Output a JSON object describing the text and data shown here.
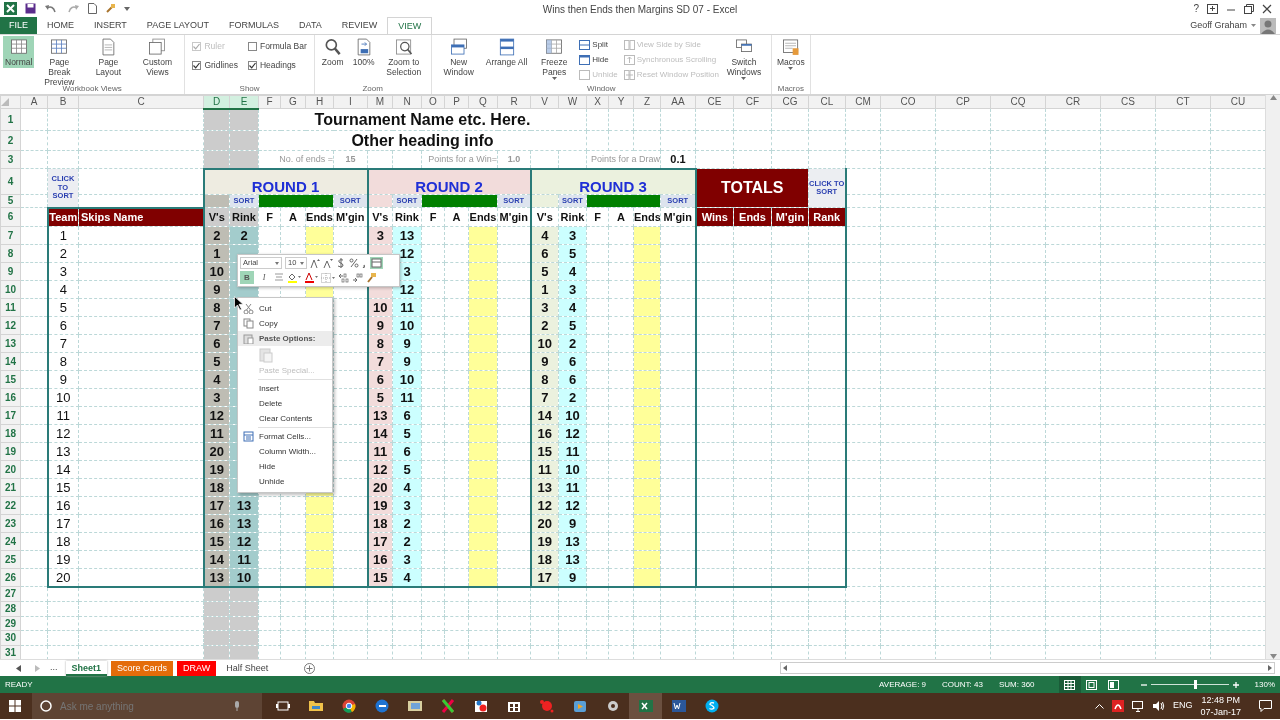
{
  "titlebar": {
    "title": "Wins then Ends then Margins SD 07 - Excel",
    "help": "?",
    "user": "Geoff Graham"
  },
  "ribbon_tabs": [
    {
      "label": "FILE",
      "kind": "file",
      "selected": false
    },
    {
      "label": "HOME",
      "kind": "tab",
      "selected": false
    },
    {
      "label": "INSERT",
      "kind": "tab",
      "selected": false
    },
    {
      "label": "PAGE LAYOUT",
      "kind": "tab",
      "selected": false
    },
    {
      "label": "FORMULAS",
      "kind": "tab",
      "selected": false
    },
    {
      "label": "DATA",
      "kind": "tab",
      "selected": false
    },
    {
      "label": "REVIEW",
      "kind": "tab",
      "selected": false
    },
    {
      "label": "VIEW",
      "kind": "tab",
      "selected": true
    }
  ],
  "ribbon_groups": [
    {
      "label": "Workbook Views",
      "items": [
        {
          "kind": "large",
          "label": "Normal",
          "selected": true,
          "disabled": false,
          "dropdown": false
        },
        {
          "kind": "large",
          "label": "Page Break Preview",
          "selected": false,
          "disabled": false,
          "dropdown": false
        },
        {
          "kind": "large",
          "label": "Page Layout",
          "selected": false,
          "disabled": false,
          "dropdown": false
        },
        {
          "kind": "large",
          "label": "Custom Views",
          "selected": false,
          "disabled": false,
          "dropdown": false
        }
      ]
    },
    {
      "label": "Show",
      "items": [
        {
          "kind": "check",
          "label": "Ruler",
          "checked": true,
          "disabled": true
        },
        {
          "kind": "check",
          "label": "Formula Bar",
          "checked": false,
          "disabled": false
        },
        {
          "kind": "check",
          "label": "Gridlines",
          "checked": true,
          "disabled": false
        },
        {
          "kind": "check",
          "label": "Headings",
          "checked": true,
          "disabled": false
        }
      ]
    },
    {
      "label": "Zoom",
      "items": [
        {
          "kind": "large",
          "label": "Zoom",
          "selected": false,
          "disabled": false,
          "dropdown": false
        },
        {
          "kind": "large",
          "label": "100%",
          "selected": false,
          "disabled": false,
          "dropdown": false
        },
        {
          "kind": "large",
          "label": "Zoom to Selection",
          "selected": false,
          "disabled": false,
          "dropdown": false
        }
      ]
    },
    {
      "label": "Window",
      "items": [
        {
          "kind": "large",
          "label": "New Window",
          "selected": false,
          "disabled": false,
          "dropdown": false
        },
        {
          "kind": "large",
          "label": "Arrange All",
          "selected": false,
          "disabled": false,
          "dropdown": false
        },
        {
          "kind": "large",
          "label": "Freeze Panes",
          "selected": false,
          "disabled": false,
          "dropdown": true
        },
        {
          "kind": "small",
          "label": "Split",
          "disabled": false
        },
        {
          "kind": "small",
          "label": "Hide",
          "disabled": false
        },
        {
          "kind": "small",
          "label": "Unhide",
          "disabled": true
        },
        {
          "kind": "small",
          "label": "View Side by Side",
          "disabled": true
        },
        {
          "kind": "small",
          "label": "Synchronous Scrolling",
          "disabled": true
        },
        {
          "kind": "small",
          "label": "Reset Window Position",
          "disabled": true
        },
        {
          "kind": "large",
          "label": "Switch Windows",
          "selected": false,
          "disabled": false,
          "dropdown": true
        }
      ]
    },
    {
      "label": "Macros",
      "items": [
        {
          "kind": "large",
          "label": "Macros",
          "selected": false,
          "disabled": false,
          "dropdown": true
        }
      ]
    }
  ],
  "columns": [
    {
      "label": "A",
      "selected": false
    },
    {
      "label": "B",
      "selected": false
    },
    {
      "label": "C",
      "selected": false
    },
    {
      "label": "D",
      "selected": true
    },
    {
      "label": "E",
      "selected": true
    },
    {
      "label": "F",
      "selected": false
    },
    {
      "label": "G",
      "selected": false
    },
    {
      "label": "H",
      "selected": false
    },
    {
      "label": "I",
      "selected": false
    },
    {
      "label": "M",
      "selected": false
    },
    {
      "label": "N",
      "selected": false
    },
    {
      "label": "O",
      "selected": false
    },
    {
      "label": "P",
      "selected": false
    },
    {
      "label": "Q",
      "selected": false
    },
    {
      "label": "R",
      "selected": false
    },
    {
      "label": "V",
      "selected": false
    },
    {
      "label": "W",
      "selected": false
    },
    {
      "label": "X",
      "selected": false
    },
    {
      "label": "Y",
      "selected": false
    },
    {
      "label": "Z",
      "selected": false
    },
    {
      "label": "AA",
      "selected": false
    },
    {
      "label": "CE",
      "selected": false
    },
    {
      "label": "CF",
      "selected": false
    },
    {
      "label": "CG",
      "selected": false
    },
    {
      "label": "CL",
      "selected": false
    },
    {
      "label": "CM",
      "selected": false
    },
    {
      "label": "CO",
      "selected": false
    },
    {
      "label": "CP",
      "selected": false
    },
    {
      "label": "CQ",
      "selected": false
    },
    {
      "label": "CR",
      "selected": false
    },
    {
      "label": "CS",
      "selected": false
    },
    {
      "label": "CT",
      "selected": false
    },
    {
      "label": "CU",
      "selected": false
    }
  ],
  "row_numbers": [
    "1",
    "2",
    "3",
    "4",
    "5",
    "6",
    "7",
    "8",
    "9",
    "10",
    "11",
    "12",
    "13",
    "14",
    "15",
    "16",
    "17",
    "18",
    "19",
    "20",
    "21",
    "22",
    "23",
    "24",
    "25",
    "26",
    "27",
    "28",
    "29",
    "30",
    "31"
  ],
  "sheet": {
    "title": "Tournament Name etc. Here.",
    "subtitle": "Other heading info",
    "settings": [
      {
        "label": "No. of ends =",
        "value": "15"
      },
      {
        "label": "Points for a Win=",
        "value": "1.0"
      },
      {
        "label": "Points for a Draw",
        "value": "0.1"
      }
    ],
    "team_sort_button": "CLICK TO SORT",
    "team_headers": [
      "Team",
      "Skips Name"
    ],
    "teams": [
      "1",
      "2",
      "3",
      "4",
      "5",
      "6",
      "7",
      "8",
      "9",
      "10",
      "11",
      "12",
      "13",
      "14",
      "15",
      "16",
      "17",
      "18",
      "19",
      "20"
    ],
    "rounds": [
      {
        "title": "ROUND 1",
        "color": "#eeece1",
        "sort_labels": [
          "SORT",
          "SORT"
        ],
        "headers": [
          "V's",
          "Rink",
          "F",
          "A",
          "Ends",
          "M'gin"
        ],
        "games": [
          {
            "vs": "2",
            "rink": "2"
          },
          {
            "vs": "1"
          },
          {
            "vs": "10"
          },
          {
            "vs": "9"
          },
          {
            "vs": "8"
          },
          {
            "vs": "7"
          },
          {
            "vs": "6"
          },
          {
            "vs": "5"
          },
          {
            "vs": "4"
          },
          {
            "vs": "3"
          },
          {
            "vs": "12"
          },
          {
            "vs": "11"
          },
          {
            "vs": "20"
          },
          {
            "vs": "19"
          },
          {
            "vs": "18"
          },
          {
            "vs": "17",
            "rink": "13"
          },
          {
            "vs": "16",
            "rink": "13"
          },
          {
            "vs": "15",
            "rink": "12"
          },
          {
            "vs": "14",
            "rink": "11"
          },
          {
            "vs": "13",
            "rink": "10"
          }
        ]
      },
      {
        "title": "ROUND 2",
        "color": "#f2dcdb",
        "sort_labels": [
          "SORT",
          "SORT"
        ],
        "headers": [
          "V's",
          "Rink",
          "F",
          "A",
          "Ends",
          "M'gin"
        ],
        "games": [
          {
            "vs": "3",
            "rink": "13"
          },
          {
            "rink": "12"
          },
          {
            "rink": "3"
          },
          {
            "rink": "12"
          },
          {
            "vs": "10",
            "rink": "11"
          },
          {
            "vs": "9",
            "rink": "10"
          },
          {
            "vs": "8",
            "rink": "9"
          },
          {
            "vs": "7",
            "rink": "9"
          },
          {
            "vs": "6",
            "rink": "10"
          },
          {
            "vs": "5",
            "rink": "11"
          },
          {
            "vs": "13",
            "rink": "6"
          },
          {
            "vs": "14",
            "rink": "5"
          },
          {
            "vs": "11",
            "rink": "6"
          },
          {
            "vs": "12",
            "rink": "5"
          },
          {
            "vs": "20",
            "rink": "4"
          },
          {
            "vs": "19",
            "rink": "3"
          },
          {
            "vs": "18",
            "rink": "2"
          },
          {
            "vs": "17",
            "rink": "2"
          },
          {
            "vs": "16",
            "rink": "3"
          },
          {
            "vs": "15",
            "rink": "4"
          }
        ]
      },
      {
        "title": "ROUND 3",
        "color": "#ebf1de",
        "sort_labels": [
          "SORT",
          "SORT"
        ],
        "headers": [
          "V's",
          "Rink",
          "F",
          "A",
          "Ends",
          "M'gin"
        ],
        "games": [
          {
            "vs": "4",
            "rink": "3"
          },
          {
            "vs": "6",
            "rink": "5"
          },
          {
            "vs": "5",
            "rink": "4"
          },
          {
            "vs": "1",
            "rink": "3"
          },
          {
            "vs": "3",
            "rink": "4"
          },
          {
            "vs": "2",
            "rink": "5"
          },
          {
            "vs": "10",
            "rink": "2"
          },
          {
            "vs": "9",
            "rink": "6"
          },
          {
            "vs": "8",
            "rink": "6"
          },
          {
            "vs": "7",
            "rink": "2"
          },
          {
            "vs": "14",
            "rink": "10"
          },
          {
            "vs": "16",
            "rink": "12"
          },
          {
            "vs": "15",
            "rink": "11"
          },
          {
            "vs": "11",
            "rink": "10"
          },
          {
            "vs": "13",
            "rink": "11"
          },
          {
            "vs": "12",
            "rink": "12"
          },
          {
            "vs": "20",
            "rink": "9"
          },
          {
            "vs": "19",
            "rink": "13"
          },
          {
            "vs": "18",
            "rink": "13"
          },
          {
            "vs": "17",
            "rink": "9"
          }
        ]
      }
    ],
    "totals": {
      "title": "TOTALS",
      "sort_button": "CLICK TO SORT",
      "headers": [
        "Wins",
        "Ends",
        "M'gin",
        "Rank"
      ]
    }
  },
  "mini_toolbar": {
    "font": "Arial",
    "size": "10",
    "buttons": [
      {
        "label": "B",
        "selected": true
      },
      {
        "label": "I",
        "selected": false
      }
    ]
  },
  "context_menu": [
    {
      "kind": "item",
      "label": "Cut",
      "disabled": false
    },
    {
      "kind": "item",
      "label": "Copy",
      "disabled": false
    },
    {
      "kind": "header",
      "label": "Paste Options:",
      "disabled": false
    },
    {
      "kind": "paste",
      "disabled": true
    },
    {
      "kind": "item",
      "label": "Paste Special...",
      "disabled": true
    },
    {
      "kind": "separator"
    },
    {
      "kind": "item",
      "label": "Insert",
      "disabled": false
    },
    {
      "kind": "item",
      "label": "Delete",
      "disabled": false
    },
    {
      "kind": "item",
      "label": "Clear Contents",
      "disabled": false
    },
    {
      "kind": "separator"
    },
    {
      "kind": "item",
      "label": "Format Cells...",
      "disabled": false
    },
    {
      "kind": "item",
      "label": "Column Width...",
      "disabled": false
    },
    {
      "kind": "item",
      "label": "Hide",
      "disabled": false
    },
    {
      "kind": "item",
      "label": "Unhide",
      "disabled": false
    }
  ],
  "sheet_tabs": {
    "overflow": "...",
    "tabs": [
      {
        "label": "Sheet1",
        "selected": true
      },
      {
        "label": "Score Cards",
        "selected": false,
        "color": "#e46c0a"
      },
      {
        "label": "DRAW",
        "selected": false,
        "color": "#ff0000"
      },
      {
        "label": "Half Sheet",
        "selected": false
      }
    ]
  },
  "status_bar": {
    "mode": "READY",
    "stats": [
      "AVERAGE: 9",
      "COUNT: 43",
      "SUM: 360"
    ],
    "views": [
      {
        "selected": true
      },
      {
        "selected": false
      },
      {
        "selected": false
      }
    ],
    "zoom_slider": {
      "level": 0.58
    },
    "zoom": "130%"
  },
  "taskbar": {
    "search_placeholder": "Ask me anything",
    "language": "ENG",
    "time": "12:48 PM",
    "date": "07-Jan-17"
  }
}
